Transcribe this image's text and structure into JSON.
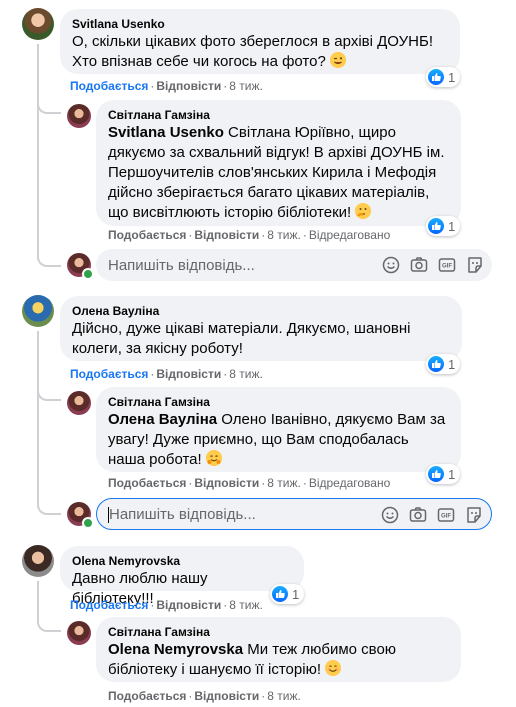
{
  "comments": [
    {
      "author": "Svitlana Usenko",
      "text": "О, скільки цікавих фото збереглося в архіві ДОУНБ! Хто впізнав себе чи когось на фото?",
      "like_label": "Подобається",
      "reply_label": "Відповісти",
      "time": "8 тиж.",
      "reactions": "1",
      "reply": {
        "author": "Світлана Гамзіна",
        "mention": "Svitlana Usenko",
        "text": " Світлана Юріївно, щиро дякуємо за схвальний відгук! В архіві ДОУНБ ім. Першоучителів слов'янських Кирила і Мефодія дійсно зберігається багато цікавих матеріалів, що висвітлюють історію бібліотеки!",
        "like_label": "Подобається",
        "reply_label": "Відповісти",
        "time": "8 тиж.",
        "edited": "Відредаговано",
        "reactions": "1"
      }
    },
    {
      "author": "Олена Вауліна",
      "text": "Дійсно, дуже цікаві матеріали. Дякуємо, шановні колеги, за якісну роботу!",
      "like_label": "Подобається",
      "reply_label": "Відповісти",
      "time": "8 тиж.",
      "reactions": "1",
      "reply": {
        "author": "Світлана Гамзіна",
        "mention": "Олена Вауліна",
        "text": " Олено Іванівно, дякуємо Вам за увагу! Дуже приємно, що Вам сподобалась наша робота!",
        "like_label": "Подобається",
        "reply_label": "Відповісти",
        "time": "8 тиж.",
        "edited": "Відредаговано",
        "reactions": "1"
      }
    },
    {
      "author": "Olena Nemyrovska",
      "text": "Давно люблю нашу бібліотеку!!!",
      "like_label": "Подобається",
      "reply_label": "Відповісти",
      "time": "8 тиж.",
      "reactions": "1",
      "reply": {
        "author": "Світлана Гамзіна",
        "mention": "Olena Nemyrovska",
        "text": " Ми теж любимо свою бібліотеку і шануємо її історію!",
        "like_label": "Подобається",
        "reply_label": "Відповісти",
        "time": "8 тиж."
      }
    }
  ],
  "reply_box": {
    "placeholder": "Напишіть відповідь..."
  },
  "icons": [
    "emoji-icon",
    "camera-icon",
    "gif-icon",
    "sticker-icon",
    "like-icon"
  ],
  "colors": {
    "link_blue": "#1877f2",
    "bubble": "#f0f2f5",
    "meta": "#65676b",
    "online": "#31a24c"
  }
}
